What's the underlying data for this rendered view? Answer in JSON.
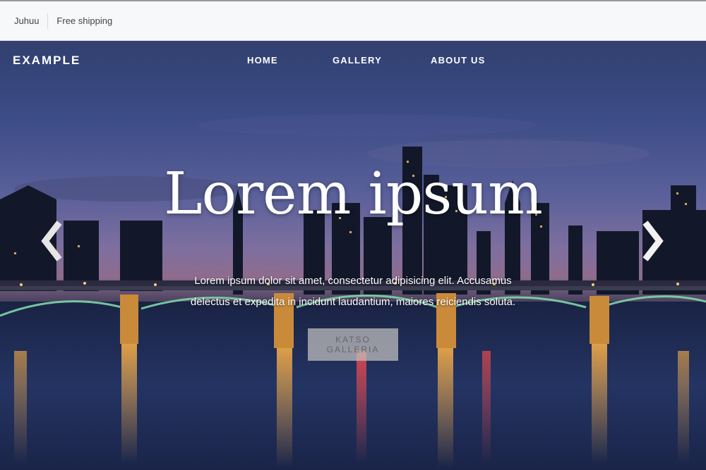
{
  "topbar": {
    "items": [
      "Juhuu",
      "Free shipping"
    ]
  },
  "header": {
    "brand": "EXAMPLE",
    "nav": [
      "HOME",
      "GALLERY",
      "ABOUT US"
    ]
  },
  "hero": {
    "title": "Lorem ipsum",
    "lead": "Lorem ipsum dolor sit amet, consectetur adipisicing elit. Accusamus delectus et expedita in incidunt laudantium, maiores reiciendis soluta.",
    "cta_label": "KATSO GALLERIA",
    "prev_icon": "chevron-left-icon",
    "next_icon": "chevron-right-icon"
  },
  "colors": {
    "topbar_bg": "#f7f8fa",
    "text_light": "#ffffff",
    "cta_bg": "#bebebe"
  }
}
